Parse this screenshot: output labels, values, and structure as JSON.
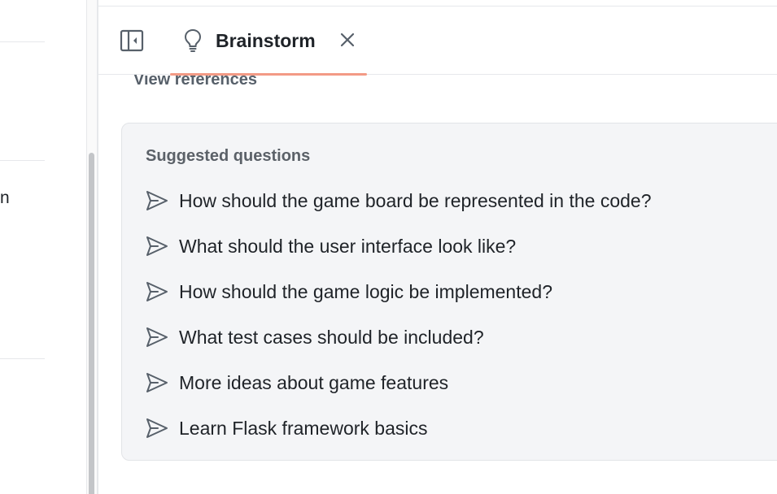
{
  "left_pane": {
    "fragment_text": "n"
  },
  "header": {
    "tab_label": "Brainstorm",
    "tab_icon": "lightbulb-icon",
    "close_icon": "close-icon",
    "toggle_icon": "sidebar-toggle-icon",
    "accent_color": "#f39a85"
  },
  "main": {
    "view_references": "View references",
    "suggested": {
      "title": "Suggested questions",
      "item_icon": "send-icon",
      "items": [
        {
          "label": "How should the game board be represented in the code?"
        },
        {
          "label": "What should the user interface look like?"
        },
        {
          "label": "How should the game logic be implemented?"
        },
        {
          "label": "What test cases should be included?"
        },
        {
          "label": "More ideas about game features"
        },
        {
          "label": "Learn Flask framework basics"
        }
      ]
    }
  }
}
